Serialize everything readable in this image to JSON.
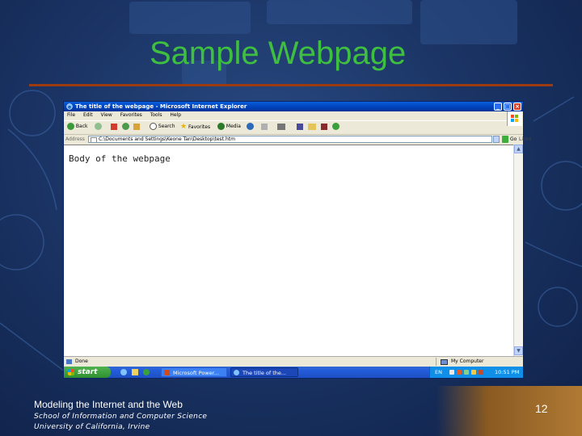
{
  "slide": {
    "title": "Sample Webpage",
    "footer_course": "Modeling the Internet and the Web",
    "footer_school": "School of Information and Computer Science",
    "footer_university": "University of California, Irvine",
    "page_number": "12",
    "colors": {
      "background": "#1b3566",
      "title": "#3fbf3f",
      "rule": "#9c3a10",
      "corner_accent": "#b07a34"
    }
  },
  "browser": {
    "window_title": "The title of the webpage - Microsoft Internet Explorer",
    "menu": [
      "File",
      "Edit",
      "View",
      "Favorites",
      "Tools",
      "Help"
    ],
    "toolbar": {
      "back_label": "Back",
      "search_label": "Search",
      "favorites_label": "Favorites",
      "media_label": "Media"
    },
    "address": {
      "label": "Address",
      "value": "C:\\Documents and Settings\\Keone Tan\\Desktop\\test.htm",
      "go_label": "Go",
      "links_label": "Links"
    },
    "content": {
      "body_text": "Body of the webpage"
    },
    "status": {
      "text": "Done",
      "zone": "My Computer"
    },
    "icons": [
      "ie-icon",
      "back-icon",
      "forward-icon",
      "stop-icon",
      "refresh-icon",
      "home-icon",
      "search-icon",
      "favorites-icon",
      "media-icon",
      "history-icon",
      "mail-icon",
      "print-icon",
      "edit-icon",
      "folder-icon",
      "messenger-icon"
    ]
  },
  "taskbar": {
    "start_label": "start",
    "tasks": [
      {
        "label": "Microsoft Power...",
        "state": "inactive"
      },
      {
        "label": "The title of the...",
        "state": "active"
      }
    ],
    "tray": {
      "language": "EN",
      "clock": "10:51 PM"
    }
  }
}
